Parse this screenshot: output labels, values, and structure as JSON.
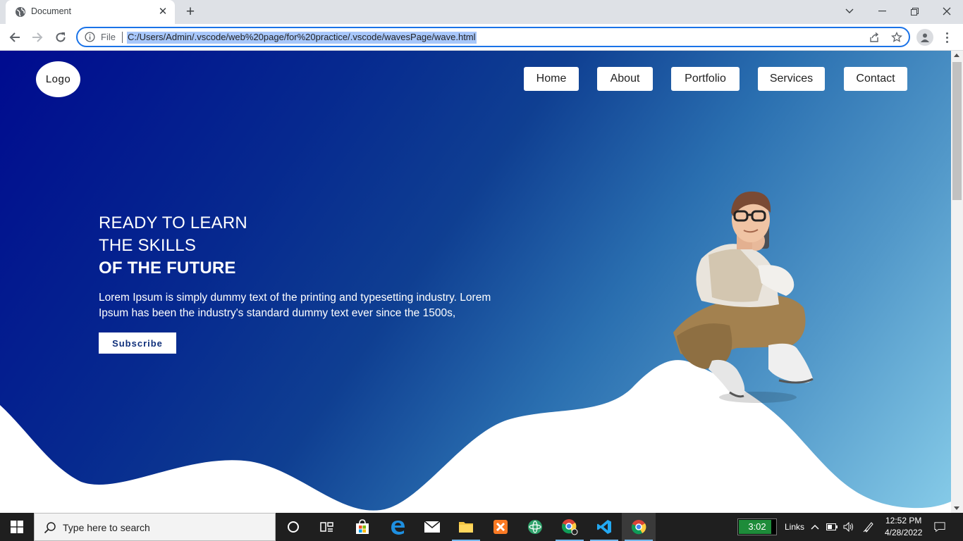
{
  "browser": {
    "tab_title": "Document",
    "tab_close": "✕",
    "new_tab": "+",
    "url_scheme": "File",
    "url": "C:/Users/Admin/.vscode/web%20page/for%20practice/.vscode/wavesPage/wave.html",
    "window_controls": [
      "chevron-down",
      "minimize",
      "restore",
      "close"
    ]
  },
  "page": {
    "logo": "Logo",
    "nav": [
      "Home",
      "About",
      "Portfolio",
      "Services",
      "Contact"
    ],
    "hero": {
      "line1": "READY TO LEARN",
      "line2": "THE SKILLS",
      "line3": "OF THE FUTURE",
      "text": "Lorem Ipsum is simply dummy text of the printing and typesetting industry. Lorem Ipsum has been the industry's standard dummy text ever since the 1500s,",
      "button": "Subscribe"
    },
    "colors": {
      "gradient_start": "#000b8f",
      "gradient_end": "#86cbe8",
      "accent": "#1a73e8"
    }
  },
  "taskbar": {
    "search_placeholder": "Type here to search",
    "apps": [
      "task-view",
      "widgets",
      "store",
      "edge",
      "mail",
      "file-explorer",
      "xampp",
      "electron",
      "chrome-profile",
      "vscode",
      "chrome"
    ],
    "battery_widget": "3:02",
    "links_label": "Links",
    "time": "12:52 PM",
    "date": "4/28/2022"
  }
}
